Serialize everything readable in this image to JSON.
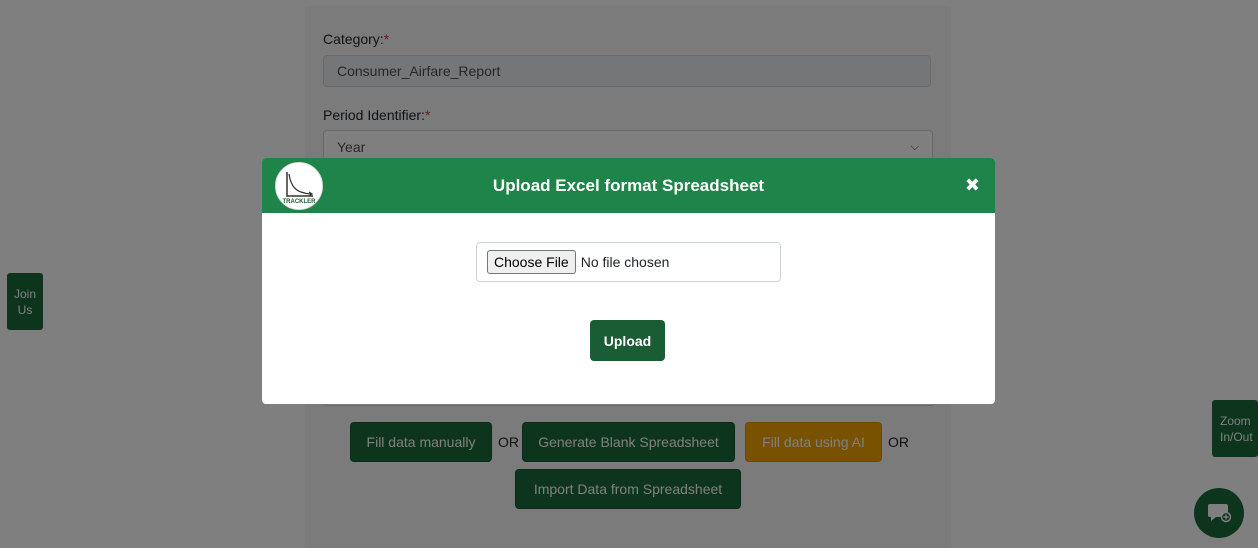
{
  "form": {
    "category_label": "Category:",
    "required_mark": "*",
    "category_value": "Consumer_Airfare_Report",
    "period_label": "Period Identifier:",
    "period_value": "Year"
  },
  "actions": {
    "fill_manually": "Fill data manually",
    "or": "OR",
    "generate_blank": "Generate Blank Spreadsheet",
    "fill_ai": "Fill data using AI",
    "import_data": "Import Data from Spreadsheet"
  },
  "side_tabs": {
    "join_line1": "Join",
    "join_line2": "Us",
    "zoom_line1": "Zoom",
    "zoom_line2": "In/Out"
  },
  "modal": {
    "title": "Upload Excel format Spreadsheet",
    "close_glyph": "✖",
    "logo_text": "TRACKLER",
    "choose_file": "Choose File",
    "no_file": "No file chosen",
    "upload": "Upload"
  },
  "colors": {
    "brand_green": "#1a6b3a",
    "header_green": "#1e8449",
    "ai_amber": "#f0a500"
  },
  "icons": {
    "chat": "chat-plus-icon",
    "close": "close-icon",
    "logo": "trackler-logo"
  }
}
